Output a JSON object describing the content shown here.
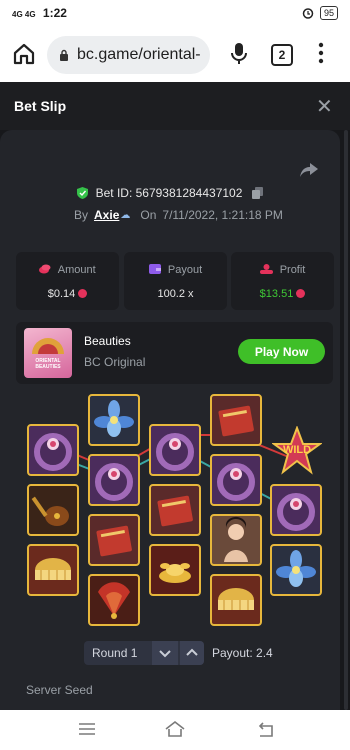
{
  "status_bar": {
    "network": "4G 4G",
    "time": "1:22",
    "battery": "95"
  },
  "browser": {
    "url": "bc.game/oriental-",
    "tab_count": "2"
  },
  "bet_slip": {
    "title": "Bet Slip",
    "bet_id": "Bet ID: 5679381284437102",
    "by_label": "By",
    "username": "Axie",
    "on_label": "On",
    "date": "7/11/2022, 1:21:18 PM"
  },
  "stats": [
    {
      "label": "Amount",
      "value": "$0.14",
      "icon": "coins-icon",
      "color": "#e4325b"
    },
    {
      "label": "Payout",
      "value": "100.2 x",
      "icon": "wallet-icon",
      "color": "#8e5bea"
    },
    {
      "label": "Profit",
      "value": "$13.51",
      "icon": "profit-icon",
      "color": "#e4325b"
    }
  ],
  "game": {
    "name": "Beauties",
    "subtitle": "BC Original",
    "play_label": "Play Now",
    "thumb_text": "ORIENTAL BEAUTIES"
  },
  "reels": {
    "wild_label": "WILD"
  },
  "round": {
    "label": "Round 1",
    "payout": "Payout: 2.4"
  },
  "server_seed_label": "Server Seed",
  "colors": {
    "accent_green": "#3fbf28",
    "profit_green": "#3fc935",
    "tile_border": "#e7b73c",
    "panel": "#23252a"
  }
}
